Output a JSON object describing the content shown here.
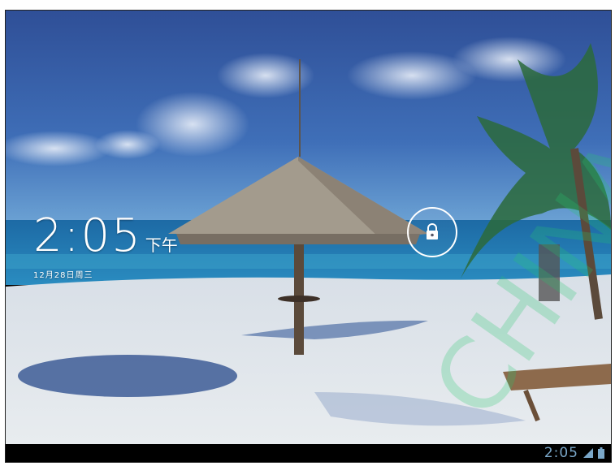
{
  "lockscreen": {
    "clock": {
      "time": "2:05",
      "ampm": "下午"
    },
    "date": "12月28日周三",
    "unlock_icon": "lock-icon"
  },
  "statusbar": {
    "time": "2:05",
    "icons": [
      "signal-icon",
      "battery-icon"
    ],
    "accent_color": "#7aa7c9"
  },
  "watermark": "CHINA"
}
